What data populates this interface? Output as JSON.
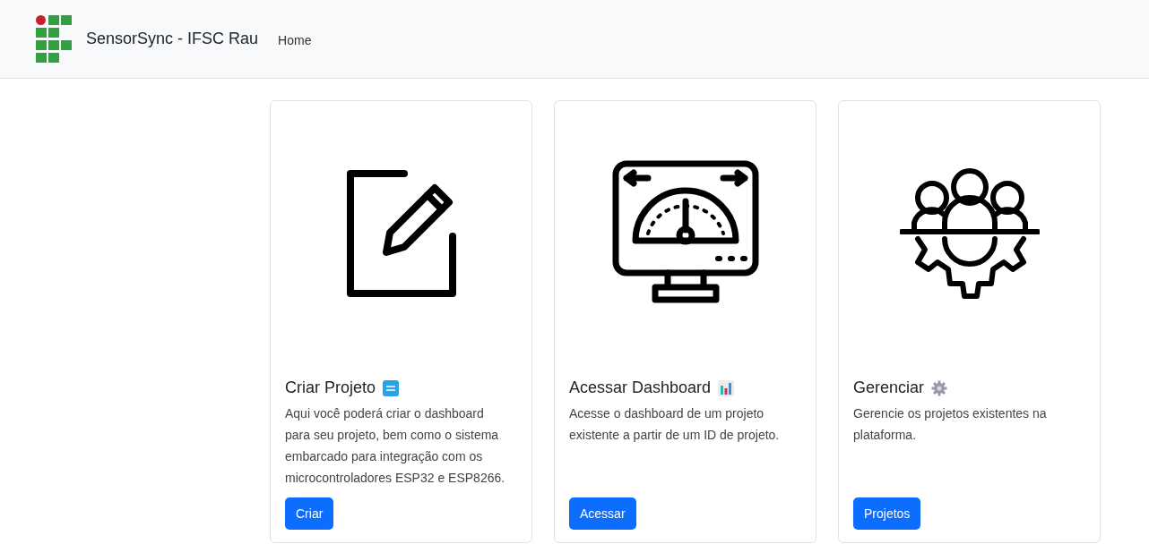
{
  "navbar": {
    "brand": "SensorSync - IFSC Rau",
    "links": [
      {
        "label": "Home"
      }
    ]
  },
  "cards": [
    {
      "kind": "edit",
      "title": "Criar Projeto",
      "badge": {
        "kind": "new"
      },
      "text": "Aqui você poderá criar o dashboard para seu projeto, bem como o sistema embarcado para integração com os microcontroladores ESP32 e ESP8266.",
      "button": "Criar"
    },
    {
      "kind": "gauge",
      "title": "Acessar Dashboard",
      "badge": {
        "kind": "chart"
      },
      "text": "Acesse o dashboard de um projeto existente a partir de um ID de projeto.",
      "button": "Acessar"
    },
    {
      "kind": "team",
      "title": "Gerenciar",
      "badge": {
        "kind": "gear"
      },
      "text": "Gerencie os projetos existentes na plataforma.",
      "button": "Projetos"
    }
  ]
}
